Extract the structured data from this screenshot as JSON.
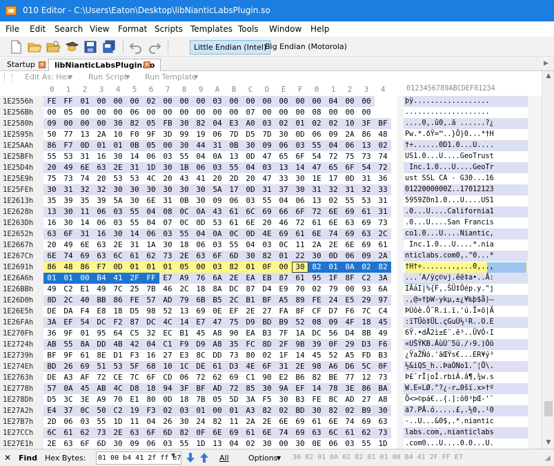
{
  "window": {
    "title": "010 Editor - C:\\Users\\Eaton\\Desktop\\libNianticLabsPlugin.so"
  },
  "menu": [
    "File",
    "Edit",
    "Search",
    "View",
    "Format",
    "Scripts",
    "Templates",
    "Tools",
    "Window",
    "Help"
  ],
  "toolbar": {
    "endian_little": "Little Endian (Intel)",
    "endian_big": "Big Endian (Motorola)"
  },
  "tabs": [
    {
      "label": "Startup"
    },
    {
      "label": "libNianticLabsPlugin.so"
    }
  ],
  "editbar": {
    "edit_as": "Edit As: Hex",
    "run_script": "Run Script",
    "run_template": "Run Template"
  },
  "column_header": {
    "hex": [
      "0",
      "1",
      "2",
      "3",
      "4",
      "5",
      "6",
      "7",
      "8",
      "9",
      "A",
      "B",
      "C",
      "D",
      "E",
      "F",
      "0",
      "1",
      "2",
      "3",
      "4"
    ],
    "ascii": "0123456789ABCDEF01234"
  },
  "rows": [
    {
      "addr": "1E2556h",
      "hex": "FE FF 01 00 00 00 02 00 00 00 03 00 00 00 00 00 00 04 00 00",
      "ascii": "þÿ.................."
    },
    {
      "addr": "1E256Bh",
      "hex": "00 05 00 00 00 06 00 00 00 00 00 00 07 00 00 00 08 00 00 00",
      "ascii": "...................."
    },
    {
      "addr": "1E2580h",
      "hex": "09 00 00 00 30 82 05 FB 30 82 04 E3 A0 03 02 01 02 02 10 3F BF",
      "ascii": "....0,.û0,.ã ......?¿"
    },
    {
      "addr": "1E2595h",
      "hex": "50 77 13 2A 10 F0 9F 3D 99 19 06 7D D5 7D 30 0D 06 09 2A 86 48",
      "ascii": "Pw.*.ðŸ=™..}Õ}0...*†H"
    },
    {
      "addr": "1E25AAh",
      "hex": "86 F7 0D 01 01 0B 05 00 30 44 31 0B 30 09 06 03 55 04 06 13 02",
      "ascii": "†÷......0D1.0...U...."
    },
    {
      "addr": "1E25BFh",
      "hex": "55 53 31 16 30 14 06 03 55 04 0A 13 0D 47 65 6F 54 72 75 73 74",
      "ascii": "US1.0...U....GeoTrust"
    },
    {
      "addr": "1E25D4h",
      "hex": "20 49 6E 63 2E 31 1D 30 1B 06 03 55 04 03 13 14 47 65 6F 54 72",
      "ascii": " Inc.1.0...U....GeoTr"
    },
    {
      "addr": "1E25E9h",
      "hex": "75 73 74 20 53 53 4C 20 43 41 20 2D 20 47 33 30 1E 17 0D 31 36",
      "ascii": "ust SSL CA - G30...16"
    },
    {
      "addr": "1E25FEh",
      "hex": "30 31 32 32 30 30 30 30 30 30 5A 17 0D 31 37 30 31 32 31 32 33",
      "ascii": "0122000000Z..17012123"
    },
    {
      "addr": "1E2613h",
      "hex": "35 39 35 39 5A 30 6E 31 0B 30 09 06 03 55 04 06 13 02 55 53 31",
      "ascii": "5959Z0n1.0...U....US1"
    },
    {
      "addr": "1E2628h",
      "hex": "13 30 11 06 03 55 04 08 0C 0A 43 61 6C 69 66 6F 72 6E 69 61 31",
      "ascii": ".0...U....California1"
    },
    {
      "addr": "1E263Dh",
      "hex": "16 30 14 06 03 55 04 07 0C 0D 53 61 6E 20 46 72 61 6E 63 69 73",
      "ascii": ".0...U....San Francis"
    },
    {
      "addr": "1E2652h",
      "hex": "63 6F 31 16 30 14 06 03 55 04 0A 0C 0D 4E 69 61 6E 74 69 63 2C",
      "ascii": "co1.0...U....Niantic,"
    },
    {
      "addr": "1E2667h",
      "hex": "20 49 6E 63 2E 31 1A 30 18 06 03 55 04 03 0C 11 2A 2E 6E 69 61",
      "ascii": " Inc.1.0...U....*.nia"
    },
    {
      "addr": "1E267Ch",
      "hex": "6E 74 69 63 6C 61 62 73 2E 63 6F 6D 30 82 01 22 30 0D 06 09 2A",
      "ascii": "nticlabs.com0,.\"0...*"
    },
    {
      "addr": "1E2691h",
      "hex": "86 48 86 F7 0D 01 01 01 05 00 03 82 01 0F 00 30 82 01 0A 02 82",
      "ascii": "†H†÷........,...0,..,"
    },
    {
      "addr": "1E26A6h",
      "hex": "01 01 00 B4 41 2F FF E7 A9 76 6A 2E EA EB 87 61 95 1F 8F C2 3A",
      "ascii": "...´A/ÿç©vj.êë‡a•..Â:"
    },
    {
      "addr": "1E26BBh",
      "hex": "49 C2 E1 49 7C 25 7B 46 2C 18 8A DC 87 D4 E9 70 02 79 00 93 6A",
      "ascii": "IÂáI|%{F,.ŠÜ‡Ôép.y.\"j"
    },
    {
      "addr": "1E26D0h",
      "hex": "8D 2C 40 BB 86 FE 57 AD 79 6B B5 2C B1 BF A5 89 FE 24 E5 29 97",
      "ascii": ".,@»†þW-ykµ,±¿¥‰þ$å)—"
    },
    {
      "addr": "1E26E5h",
      "hex": "DE DA F4 E8 18 D5 98 52 13 69 0E EF 2E 27 FA 8F CF D7 F6 7C C4",
      "ascii": "ÞÚôè.Õ˜R.i.ï.'ú.Ï×ö|Ä"
    },
    {
      "addr": "1E26FAh",
      "hex": "3A EF 54 DC F2 87 DC 4C 14 E7 47 75 D9 BD B9 52 08 09 4F 18 45",
      "ascii": ":ïTÜò‡ÜL.çGuÙ½¹R..O.E"
    },
    {
      "addr": "1E270Fh",
      "hex": "36 9F 01 95 64 C5 32 EC B1 45 A8 90 EA B3 7F 1A DC 56 D4 8B 49",
      "ascii": "6Ÿ.•dÅ2ì±E¨.ê³..ÜVÔ‹I"
    },
    {
      "addr": "1E2724h",
      "hex": "AB 55 8A DD 4B 42 04 C1 F9 D9 A8 35 FC 8D 2F 9B 39 0F 29 D3 F6",
      "ascii": "«UŠÝKB.ÁùÙ¨5ü./›9.)Óö"
    },
    {
      "addr": "1E2739h",
      "hex": "BF 9F 61 8E D1 F3 16 27 E3 8C DD 73 80 02 1F 14 45 52 A5 FD B3",
      "ascii": "¿ŸaŽÑó.'ãŒÝs€...ER¥ý³"
    },
    {
      "addr": "1E274Eh",
      "hex": "BD 26 69 51 53 5F 68 10 1C DE 61 D3 4E 6F 31 2E 98 A6 D6 5C 0F",
      "ascii": "½&iQS_h..ÞaÓNo1.˜¦Ö\\."
    },
    {
      "addr": "1E2763h",
      "hex": "DE A3 AF 72 CE 7C 6F CD 06 72 62 69 C1 90 E2 B6 82 BE 77 12 73",
      "ascii": "Þ£¯rÎ|oÍ.rbiÁ.â¶‚¾w.s"
    },
    {
      "addr": "1E2778h",
      "hex": "57 0A 45 AB 4C D8 18 94 3F BF AD 72 85 30 9A EF 14 78 3E 86 BA",
      "ascii": "W.E«LØ.\"?¿-r…0šï.x>†º"
    },
    {
      "addr": "1E278Dh",
      "hex": "D5 3C 3E A9 70 E1 80 0D 18 7B 05 5D 3A F5 30 B3 FE 8C AD 27 A8",
      "ascii": "Õ<>©pá€..{.]:õ0³þŒ-'¨"
    },
    {
      "addr": "1E27A2h",
      "hex": "E4 37 0C 50 C2 19 F3 02 03 01 00 01 A3 82 02 BD 30 82 02 B9 30",
      "ascii": "ä7.PÂ.ó.....£,.½0,.¹0"
    },
    {
      "addr": "1E27B7h",
      "hex": "2D 06 03 55 1D 11 04 26 30 24 82 11 2A 2E 6E 69 61 6E 74 69 63",
      "ascii": "-..U...&0$,.*.niantic"
    },
    {
      "addr": "1E27CCh",
      "hex": "6C 61 62 73 2E 63 6F 6D 82 0F 6E 69 61 6E 74 69 63 6C 61 62 73",
      "ascii": "labs.com,.nianticlabs"
    },
    {
      "addr": "1E27E1h",
      "hex": "2E 63 6F 6D 30 09 06 03 55 1D 13 04 02 30 00 30 0E 06 03 55 1D",
      "ascii": ".com0...U....0.0...U."
    }
  ],
  "findbar": {
    "find_label": "Find",
    "type_label": "Hex Bytes:",
    "search_value": "01 00 b4 41 2f ff e7",
    "all_label": "All",
    "options_label": "Options",
    "hex_preview": "30 82 01 0A 02 82 01 01 00 B4 41 2F FF E7"
  },
  "colors": {
    "titlebar": "#1a7fe0",
    "selection": "#1e74d0",
    "highlight": "#fff78c",
    "row_alt": "#dde0f2"
  }
}
